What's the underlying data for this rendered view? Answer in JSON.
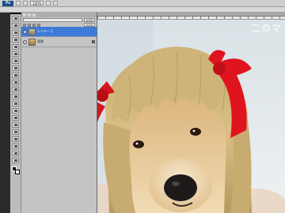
{
  "app": {
    "logo": "Ps",
    "zoom_value": "100%",
    "watermark": "二のマ"
  },
  "panel": {
    "tabs": [
      "",
      "",
      ""
    ],
    "blend_mode": "",
    "opacity_value": "100%",
    "fill_value": "100%",
    "layers": [
      {
        "name": "レイヤー 1",
        "active": true
      },
      {
        "name": "背景",
        "active": false
      }
    ]
  },
  "document": {
    "tab_title": ""
  },
  "colors": {
    "accent": "#3d7bd9",
    "ribbon": "#d8141e",
    "wig": "#d2b67d",
    "dog": "#e3c08e"
  }
}
